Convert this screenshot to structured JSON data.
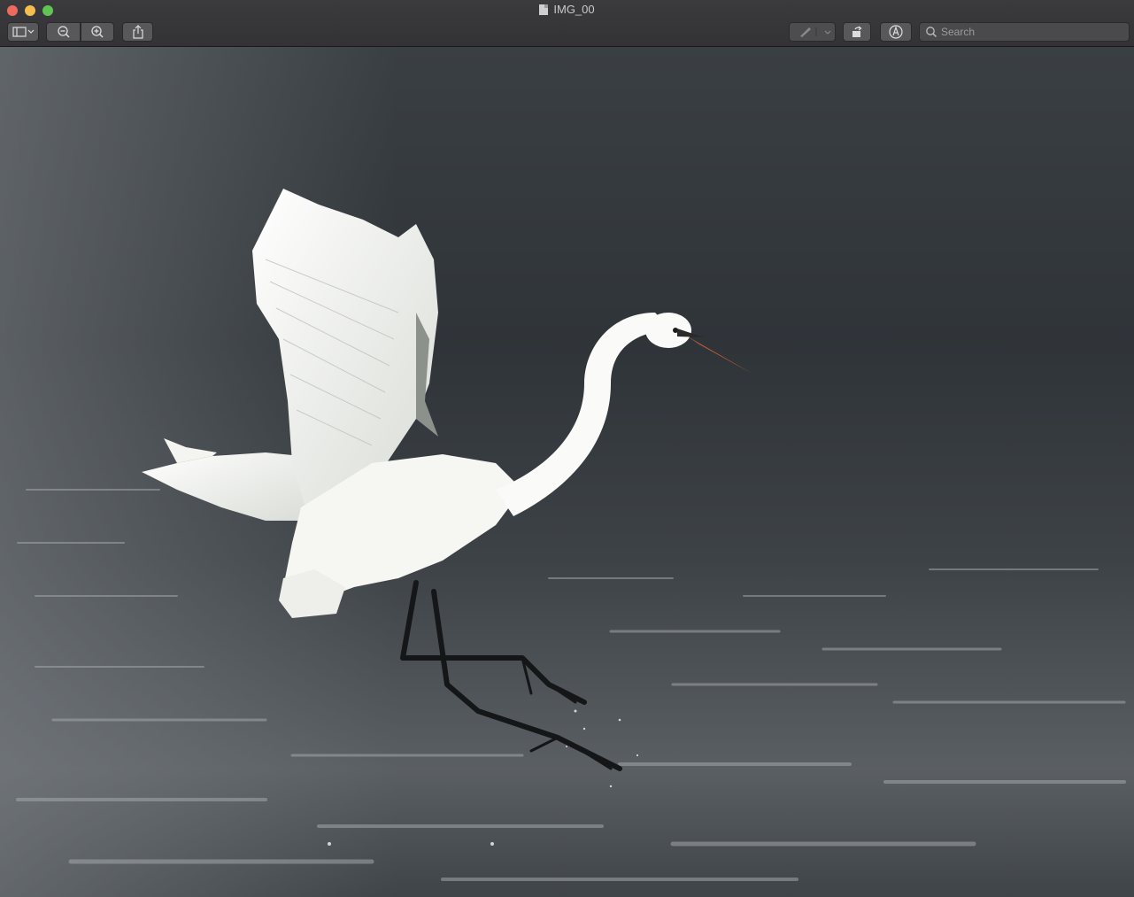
{
  "window": {
    "title": "IMG_00"
  },
  "toolbar": {
    "sidebar_button": "sidebar-icon",
    "zoom_out_button": "zoom-out-icon",
    "zoom_in_button": "zoom-in-icon",
    "share_button": "share-icon",
    "markup_pen_button": "pen-icon",
    "rotate_button": "rotate-icon",
    "annotate_button": "markup-icon"
  },
  "search": {
    "placeholder": "Search",
    "value": ""
  },
  "colors": {
    "titlebar": "#363538",
    "close": "#ed6a5e",
    "minimize": "#f5bf4f",
    "maximize": "#61c554"
  },
  "image": {
    "subject": "egret-photo"
  }
}
